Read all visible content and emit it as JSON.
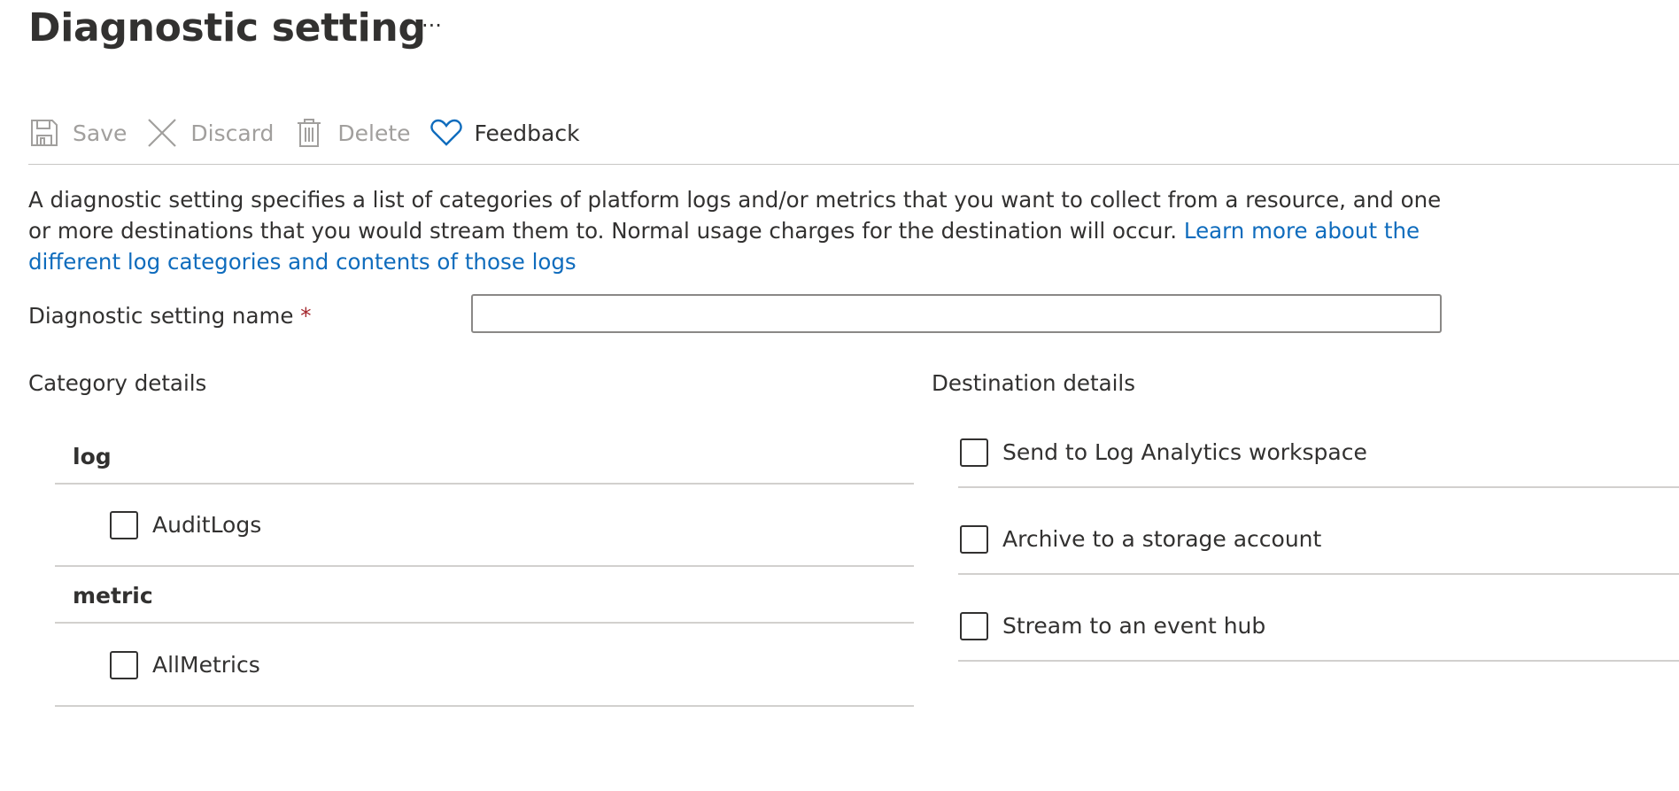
{
  "header": {
    "title": "Diagnostic setting",
    "more_label": "···"
  },
  "toolbar": {
    "save_label": "Save",
    "discard_label": "Discard",
    "delete_label": "Delete",
    "feedback_label": "Feedback"
  },
  "description": {
    "text": "A diagnostic setting specifies a list of categories of platform logs and/or metrics that you want to collect from a resource, and one or more destinations that you would stream them to. Normal usage charges for the destination will occur. ",
    "link_text": "Learn more about the different log categories and contents of those logs"
  },
  "name_field": {
    "label": "Diagnostic setting name",
    "required_marker": "*",
    "value": ""
  },
  "category_details": {
    "heading": "Category details",
    "groups": [
      {
        "title": "log",
        "items": [
          {
            "label": "AuditLogs",
            "checked": false
          }
        ]
      },
      {
        "title": "metric",
        "items": [
          {
            "label": "AllMetrics",
            "checked": false
          }
        ]
      }
    ]
  },
  "destination_details": {
    "heading": "Destination details",
    "items": [
      {
        "label": "Send to Log Analytics workspace",
        "checked": false
      },
      {
        "label": "Archive to a storage account",
        "checked": false
      },
      {
        "label": "Stream to an event hub",
        "checked": false
      }
    ]
  },
  "colors": {
    "link": "#0f6cbd",
    "required": "#a4262c",
    "disabled_text": "#a19f9d",
    "text": "#323130"
  }
}
